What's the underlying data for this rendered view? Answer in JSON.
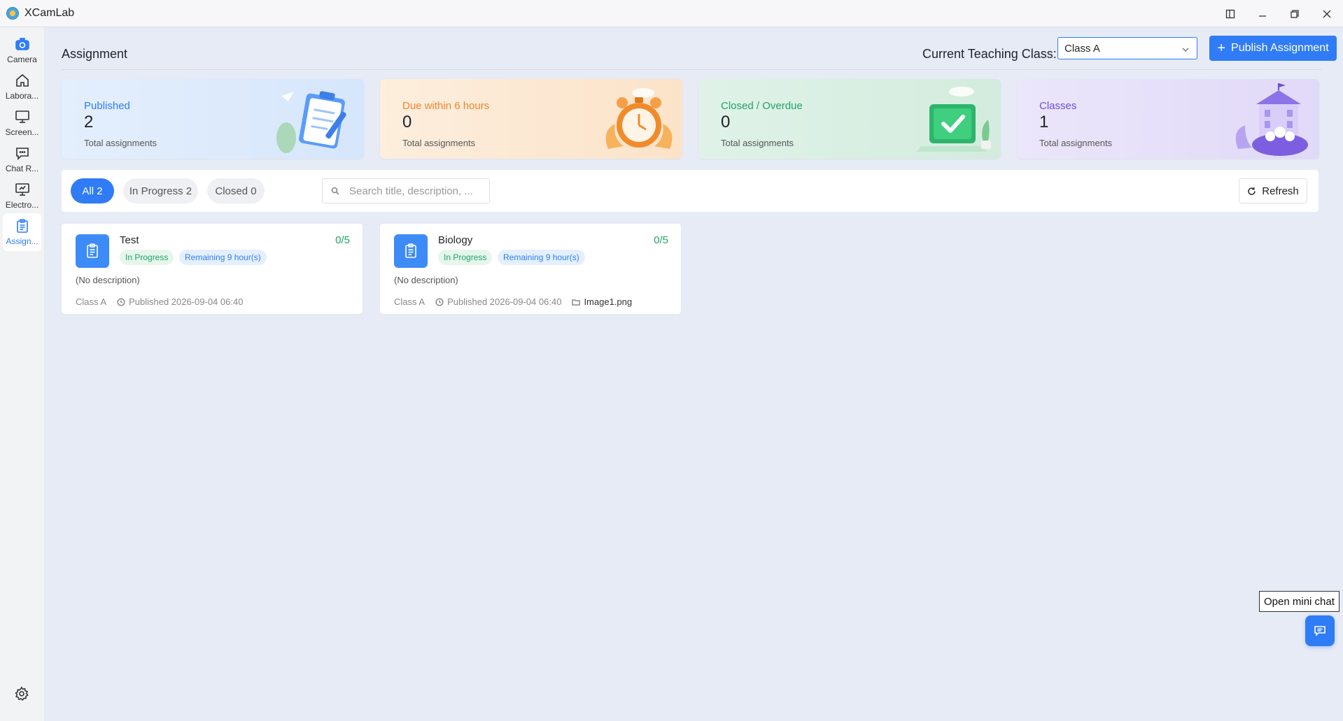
{
  "app": {
    "title": "XCamLab"
  },
  "sidebar": {
    "items": [
      {
        "label": "Camera",
        "icon": "camera-icon"
      },
      {
        "label": "Labora...",
        "icon": "home-icon"
      },
      {
        "label": "Screen...",
        "icon": "monitor-icon"
      },
      {
        "label": "Chat R...",
        "icon": "chat-icon"
      },
      {
        "label": "Electro...",
        "icon": "whiteboard-icon"
      },
      {
        "label": "Assign...",
        "icon": "clipboard-icon",
        "active": true
      }
    ],
    "settings_icon": "gear-icon"
  },
  "header": {
    "title": "Assignment",
    "class_label": "Current Teaching Class:",
    "class_selected": "Class A",
    "publish_label": "Publish Assignment"
  },
  "stats": [
    {
      "title": "Published",
      "value": "2",
      "sub": "Total assignments",
      "color": "#2f7cf6"
    },
    {
      "title": "Due within 6 hours",
      "value": "0",
      "sub": "Total assignments",
      "color": "#f0852d"
    },
    {
      "title": "Closed / Overdue",
      "value": "0",
      "sub": "Total assignments",
      "color": "#21a366"
    },
    {
      "title": "Classes",
      "value": "1",
      "sub": "Total assignments",
      "color": "#6a4fd6"
    }
  ],
  "filters": {
    "all": "All 2",
    "in_progress": "In Progress 2",
    "closed": "Closed 0",
    "search_placeholder": "Search title, description, ...",
    "refresh_label": "Refresh"
  },
  "assignments": [
    {
      "title": "Test",
      "count": "0/5",
      "status": "In Progress",
      "remaining": "Remaining 9 hour(s)",
      "description": "(No description)",
      "class": "Class A",
      "published": "Published 2026-09-04 06:40",
      "file": ""
    },
    {
      "title": "Biology",
      "count": "0/5",
      "status": "In Progress",
      "remaining": "Remaining 9 hour(s)",
      "description": "(No description)",
      "class": "Class A",
      "published": "Published 2026-09-04 06:40",
      "file": "Image1.png"
    }
  ],
  "mini_chat": {
    "tooltip": "Open mini chat"
  },
  "colors": {
    "accent": "#2f7cf6",
    "success": "#21a366",
    "warning": "#f0852d",
    "purple": "#6a4fd6"
  }
}
